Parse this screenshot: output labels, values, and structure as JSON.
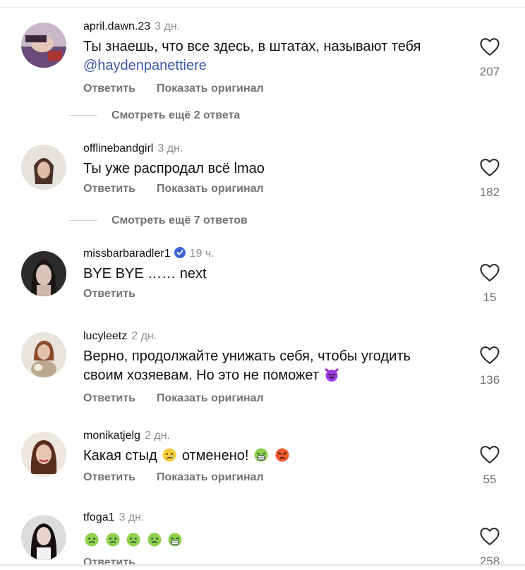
{
  "comments": [
    {
      "username": "april.dawn.23",
      "time": "3 дн.",
      "text": "Ты знаешь, что все здесь, в штатах, называют тебя",
      "mention": "@haydenpanettiere",
      "reply": "Ответить",
      "translate": "Показать оригинал",
      "likes": "207"
    },
    {
      "username": "offlinebandgirl",
      "time": "3 дн.",
      "text": "Ты уже распродал всё lmao",
      "reply": "Ответить",
      "translate": "Показать оригинал",
      "likes": "182"
    },
    {
      "username": "missbarbaradler1",
      "time": "19 ч.",
      "text": "BYE BYE …… next",
      "reply": "Ответить",
      "likes": "15"
    },
    {
      "username": "lucyleetz",
      "time": "2 дн.",
      "text_line1": "Верно, продолжайте унижать себя, чтобы угодить",
      "text_line2": "своим хозяевам. Но это не поможет",
      "reply": "Ответить",
      "translate": "Показать оригинал",
      "likes": "136"
    },
    {
      "username": "monikatjelg",
      "time": "2 дн.",
      "text_a": "Какая стыд",
      "text_b": "отменено!",
      "reply": "Ответить",
      "translate": "Показать оригинал",
      "likes": "55"
    },
    {
      "username": "tfoga1",
      "time": "3 дн.",
      "reply": "Ответить",
      "likes": "258"
    }
  ],
  "view_replies": [
    "Смотреть ещё 2 ответа",
    "Смотреть ещё 7 ответов"
  ]
}
